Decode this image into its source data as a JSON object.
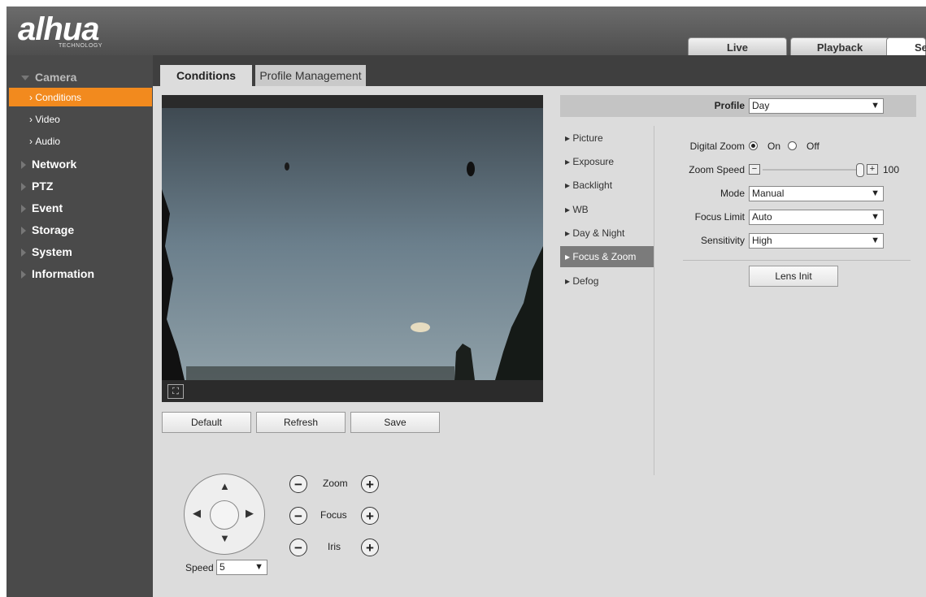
{
  "brand": {
    "name": "alhua",
    "sub": "TECHNOLOGY"
  },
  "top_tabs": [
    "Live",
    "Playback",
    "Se"
  ],
  "sidebar": {
    "camera": "Camera",
    "sub_items": [
      "Conditions",
      "Video",
      "Audio"
    ],
    "items": [
      "Network",
      "PTZ",
      "Event",
      "Storage",
      "System",
      "Information"
    ]
  },
  "tabs": {
    "conditions": "Conditions",
    "profile_management": "Profile Management"
  },
  "video_buttons": {
    "default": "Default",
    "refresh": "Refresh",
    "save": "Save"
  },
  "ptz": {
    "zoom_label": "Zoom",
    "focus_label": "Focus",
    "iris_label": "Iris",
    "speed_label": "Speed",
    "speed_value": "5"
  },
  "profile": {
    "label": "Profile",
    "value": "Day"
  },
  "settings_menu": [
    "Picture",
    "Exposure",
    "Backlight",
    "WB",
    "Day & Night",
    "Focus & Zoom",
    "Defog"
  ],
  "settings_menu_active": "Focus & Zoom",
  "focus_zoom": {
    "digital_zoom_label": "Digital Zoom",
    "on_label": "On",
    "off_label": "Off",
    "digital_zoom_selected": "On",
    "zoom_speed_label": "Zoom Speed",
    "zoom_speed_value": "100",
    "mode_label": "Mode",
    "mode_value": "Manual",
    "focus_limit_label": "Focus Limit",
    "focus_limit_value": "Auto",
    "sensitivity_label": "Sensitivity",
    "sensitivity_value": "High",
    "lens_init": "Lens Init"
  }
}
